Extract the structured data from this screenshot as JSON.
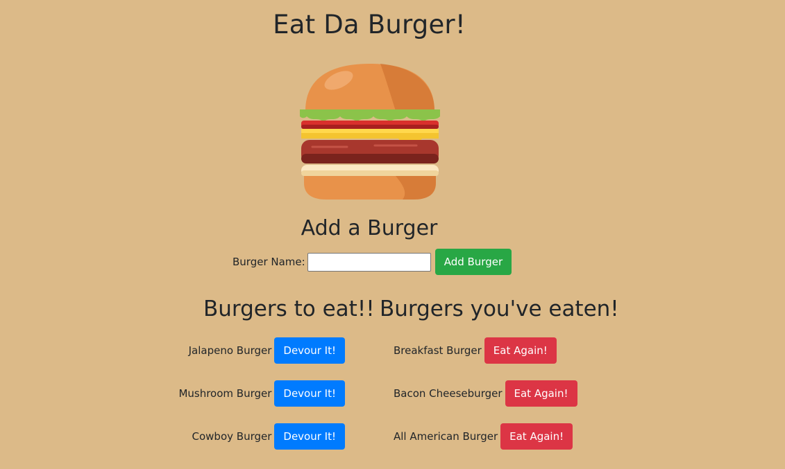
{
  "page": {
    "title": "Eat Da Burger!"
  },
  "add_form": {
    "heading": "Add a Burger",
    "label": "Burger Name:",
    "input_value": "",
    "button_label": "Add Burger"
  },
  "to_eat": {
    "heading": "Burgers to eat!!",
    "button_label": "Devour It!",
    "items": [
      {
        "name": "Jalapeno Burger"
      },
      {
        "name": "Mushroom Burger"
      },
      {
        "name": "Cowboy Burger"
      }
    ]
  },
  "eaten": {
    "heading": "Burgers you've eaten!",
    "button_label": "Eat Again!",
    "items": [
      {
        "name": "Breakfast Burger"
      },
      {
        "name": "Bacon Cheeseburger"
      },
      {
        "name": "All American Burger"
      }
    ]
  },
  "colors": {
    "background": "#dcba88",
    "success": "#28a745",
    "primary": "#007bff",
    "danger": "#dc3545"
  },
  "icons": {
    "hero": "burger-illustration"
  }
}
